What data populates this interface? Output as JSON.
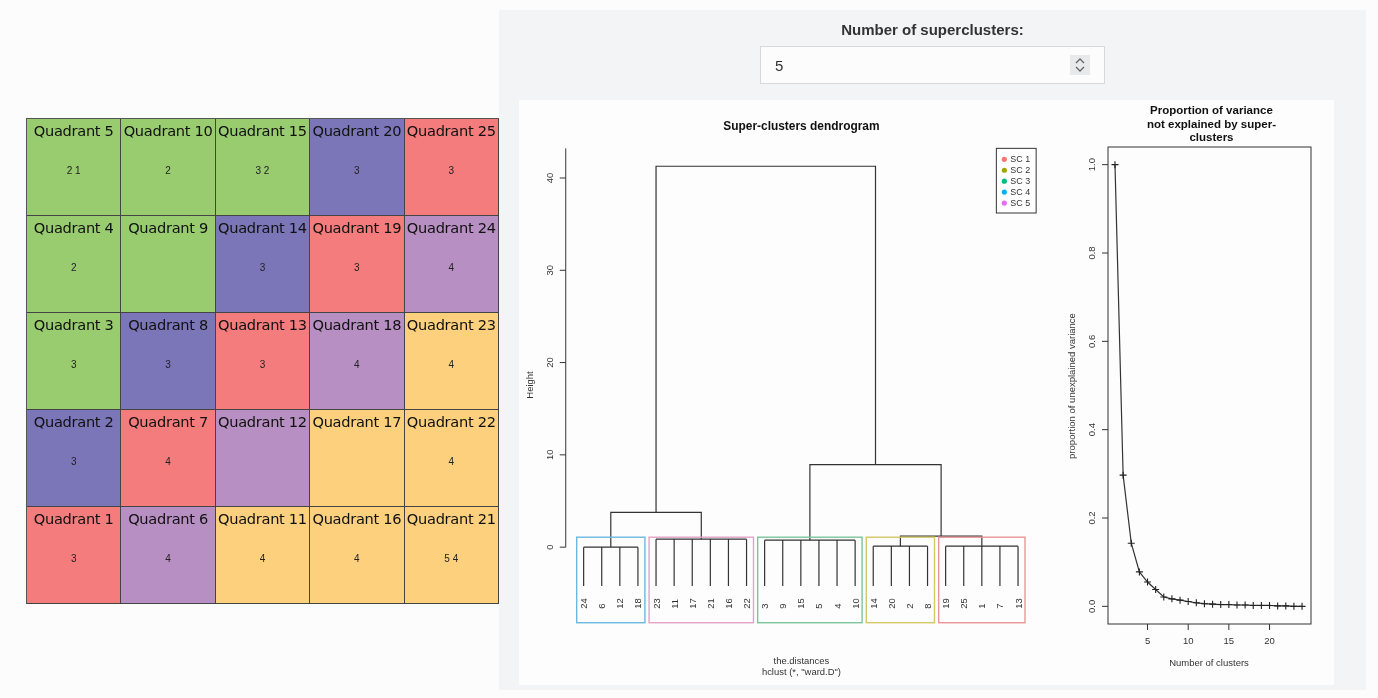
{
  "quadrants": [
    {
      "label": "Quadrant 5",
      "value": "2 1",
      "color": "#98cc6e"
    },
    {
      "label": "Quadrant 10",
      "value": "2",
      "color": "#98cc6e"
    },
    {
      "label": "Quadrant 15",
      "value": "3 2",
      "color": "#98cc6e"
    },
    {
      "label": "Quadrant 20",
      "value": "3",
      "color": "#7a76b8"
    },
    {
      "label": "Quadrant 25",
      "value": "3",
      "color": "#f47c7c"
    },
    {
      "label": "Quadrant 4",
      "value": "2",
      "color": "#98cc6e"
    },
    {
      "label": "Quadrant 9",
      "color": "#98cc6e"
    },
    {
      "label": "Quadrant 14",
      "value": "3",
      "color": "#7a76b8"
    },
    {
      "label": "Quadrant 19",
      "value": "3",
      "color": "#f47c7c"
    },
    {
      "label": "Quadrant 24",
      "value": "4",
      "color": "#b78fc2"
    },
    {
      "label": "Quadrant 3",
      "value": "3",
      "color": "#98cc6e"
    },
    {
      "label": "Quadrant 8",
      "value": "3",
      "color": "#7a76b8"
    },
    {
      "label": "Quadrant 13",
      "value": "3",
      "color": "#f47c7c"
    },
    {
      "label": "Quadrant 18",
      "value": "4",
      "color": "#b78fc2"
    },
    {
      "label": "Quadrant 23",
      "value": "4",
      "color": "#fdd07e"
    },
    {
      "label": "Quadrant 2",
      "value": "3",
      "color": "#7a76b8"
    },
    {
      "label": "Quadrant 7",
      "value": "4",
      "color": "#f47c7c"
    },
    {
      "label": "Quadrant 12",
      "color": "#b78fc2"
    },
    {
      "label": "Quadrant 17",
      "color": "#fdd07e"
    },
    {
      "label": "Quadrant 22",
      "value": "4",
      "color": "#fdd07e"
    },
    {
      "label": "Quadrant 1",
      "value": "3",
      "color": "#f47c7c"
    },
    {
      "label": "Quadrant 6",
      "value": "4",
      "color": "#b78fc2"
    },
    {
      "label": "Quadrant 11",
      "value": "4",
      "color": "#fdd07e"
    },
    {
      "label": "Quadrant 16",
      "value": "4",
      "color": "#fdd07e"
    },
    {
      "label": "Quadrant 21",
      "value": "5 4",
      "color": "#fdd07e"
    }
  ],
  "superclusters": {
    "label": "Number of superclusters:",
    "value": "5"
  },
  "dendrogram": {
    "title": "Super-clusters dendrogram",
    "ylabel": "Height",
    "yticks": [
      "0",
      "10",
      "20",
      "30",
      "40"
    ],
    "legend": [
      {
        "label": "SC 1",
        "color": "#f8766d"
      },
      {
        "label": "SC 2",
        "color": "#a3a500"
      },
      {
        "label": "SC 3",
        "color": "#00bf7d"
      },
      {
        "label": "SC 4",
        "color": "#00b0f6"
      },
      {
        "label": "SC 5",
        "color": "#e76bf3"
      }
    ],
    "clusters": [
      {
        "color": "#6ab7e0",
        "leaves": [
          "24",
          "6",
          "12",
          "18"
        ]
      },
      {
        "color": "#e2a3c4",
        "leaves": [
          "23",
          "11",
          "17",
          "21",
          "16",
          "22"
        ]
      },
      {
        "color": "#7cc49c",
        "leaves": [
          "3",
          "9",
          "15",
          "5",
          "4",
          "10"
        ]
      },
      {
        "color": "#d6c766",
        "leaves": [
          "14",
          "20",
          "2",
          "8"
        ]
      },
      {
        "color": "#e89494",
        "leaves": [
          "19",
          "25",
          "1",
          "7",
          "13"
        ]
      }
    ],
    "xlabel": "the.distances",
    "subtitle": "hclust (*, \"ward.D\")"
  },
  "variance_plot": {
    "chart_data": {
      "type": "line",
      "title": "Proportion of variance not explained by super-clusters",
      "xlabel": "Number of clusters",
      "ylabel": "proportion of unexplained variance",
      "x": [
        1,
        2,
        3,
        4,
        5,
        6,
        7,
        8,
        9,
        10,
        11,
        12,
        13,
        14,
        15,
        16,
        17,
        18,
        19,
        20,
        21,
        22,
        23,
        24
      ],
      "values": [
        1.0,
        0.297,
        0.143,
        0.078,
        0.055,
        0.038,
        0.021,
        0.017,
        0.014,
        0.011,
        0.008,
        0.006,
        0.005,
        0.004,
        0.004,
        0.003,
        0.003,
        0.002,
        0.002,
        0.002,
        0.001,
        0.001,
        0.0,
        0.0
      ],
      "marker": "+",
      "xticks": [
        5,
        10,
        15,
        20
      ],
      "xlim": [
        0.14,
        25.1
      ],
      "ylim": [
        -0.04,
        1.04
      ],
      "yticks": [
        {
          "value": 0,
          "label": "0.0"
        },
        {
          "value": 0.2,
          "label": "0.2"
        },
        {
          "value": 0.4,
          "label": "0.4"
        },
        {
          "value": 0.6,
          "label": "0.6"
        },
        {
          "value": 0.8,
          "label": "0.8"
        },
        {
          "value": 1.0,
          "label": "1.0"
        }
      ]
    }
  }
}
